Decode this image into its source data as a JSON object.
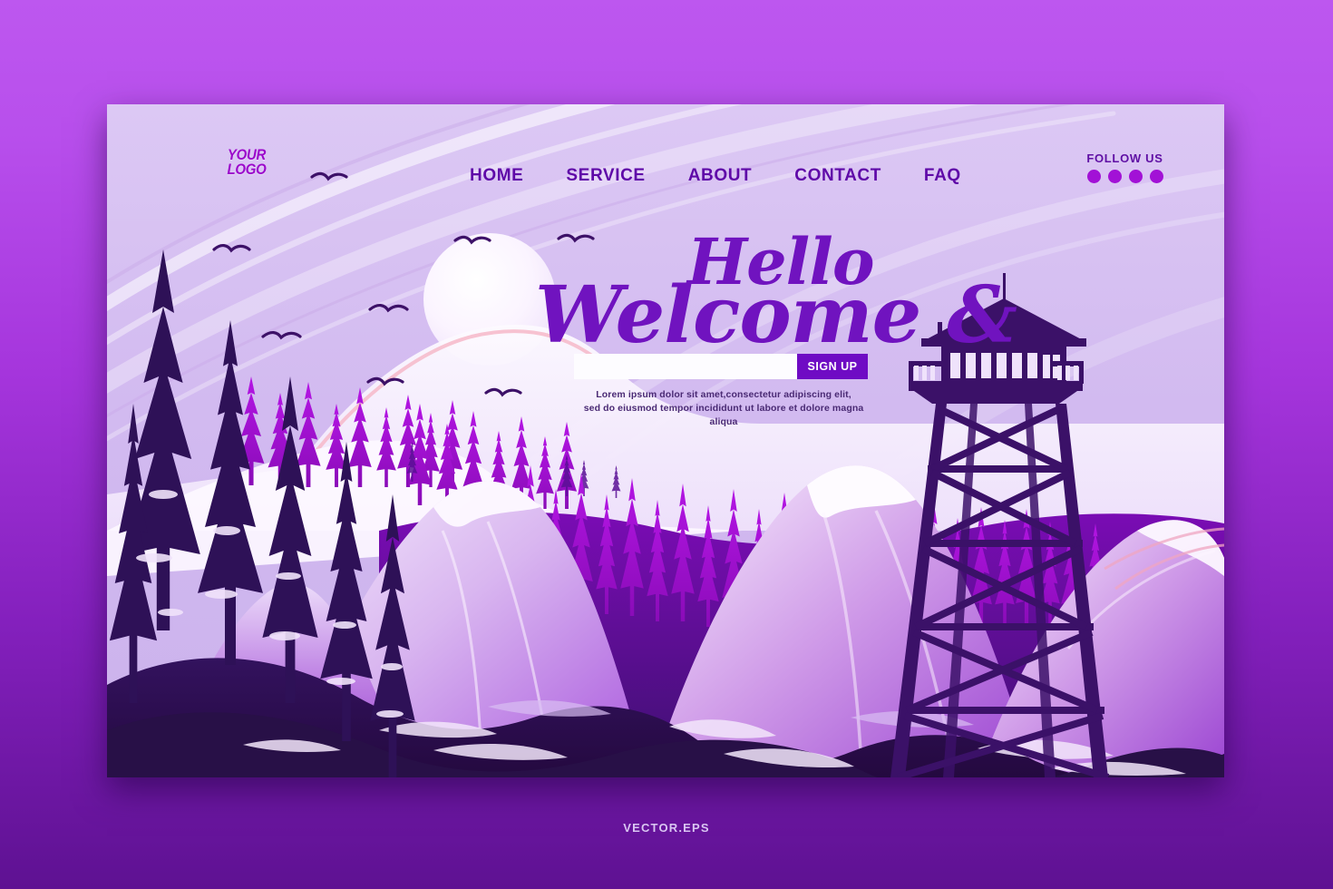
{
  "page": {
    "footer_label": "VECTOR.EPS",
    "bg_color_top": "#bd57ef",
    "bg_color_bottom": "#5e1192"
  },
  "brand": {
    "logo_line1": "YOUR",
    "logo_line2": "LOGO",
    "logo_color": "#9b07cb"
  },
  "nav": {
    "items": [
      {
        "label": "HOME"
      },
      {
        "label": "SERVICE"
      },
      {
        "label": "ABOUT"
      },
      {
        "label": "CONTACT"
      },
      {
        "label": "FAQ"
      }
    ],
    "link_color": "#5f09a8"
  },
  "follow": {
    "label": "FOLLOW US",
    "icon_count": 4,
    "icon_color": "#a211d6"
  },
  "hero": {
    "headline_line1": "Hello",
    "headline_line2": "Welcome &",
    "headline_color": "#7013bf"
  },
  "signup": {
    "email_value": "",
    "email_placeholder": "",
    "button_label": "SIGN UP",
    "button_color": "#6f0bc4",
    "description_line1": "Lorem ipsum dolor sit amet,consectetur adipiscing elit,",
    "description_line2": "sed do eiusmod tempor incididunt ut labore et dolore magna aliqua"
  },
  "illustration": {
    "sky_color": "#d2baf0",
    "snow_color": "#fbf6ff",
    "forest_near_color": "#2e1157",
    "forest_mid_color": "#a40fd8",
    "mountain_color": "#b06ae0",
    "tower_color": "#3b1168",
    "accent_pink": "#f2a0bd",
    "bird_count": 8,
    "subjects": [
      "sun",
      "pine-forest",
      "snow-mountains",
      "fire-lookout-tower",
      "birds"
    ]
  }
}
